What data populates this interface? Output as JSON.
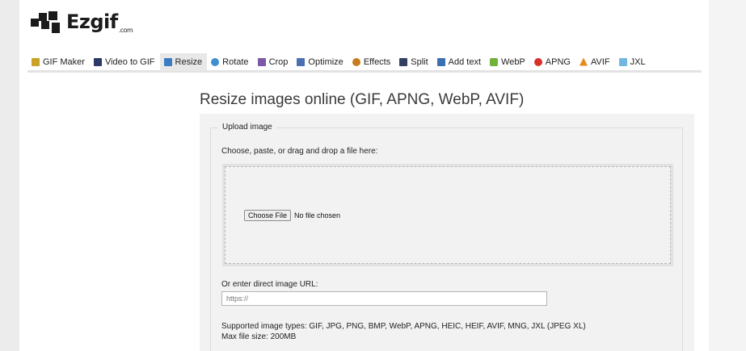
{
  "brand": {
    "name": "Ezgif",
    "suffix": ".com"
  },
  "nav": {
    "items": [
      {
        "label": "GIF Maker",
        "icon": "gif-maker-icon",
        "color": "#c9a227"
      },
      {
        "label": "Video to GIF",
        "icon": "film-icon",
        "color": "#2b3a67"
      },
      {
        "label": "Resize",
        "icon": "resize-icon",
        "color": "#3c7bc4",
        "active": true
      },
      {
        "label": "Rotate",
        "icon": "rotate-icon",
        "color": "#3c8fd1"
      },
      {
        "label": "Crop",
        "icon": "crop-icon",
        "color": "#7a5aa8"
      },
      {
        "label": "Optimize",
        "icon": "optimize-icon",
        "color": "#4a6fb3"
      },
      {
        "label": "Effects",
        "icon": "effects-icon",
        "color": "#c77a1e"
      },
      {
        "label": "Split",
        "icon": "split-icon",
        "color": "#333f63"
      },
      {
        "label": "Add text",
        "icon": "add-text-icon",
        "color": "#3b6fb0"
      },
      {
        "label": "WebP",
        "icon": "webp-icon",
        "color": "#6fb23a"
      },
      {
        "label": "APNG",
        "icon": "apng-icon",
        "color": "#d9302c"
      },
      {
        "label": "AVIF",
        "icon": "avif-icon",
        "color": "#e8891f"
      },
      {
        "label": "JXL",
        "icon": "jxl-icon",
        "color": "#6fb8e0"
      }
    ]
  },
  "page": {
    "title": "Resize images online (GIF, APNG, WebP, AVIF)"
  },
  "upload": {
    "legend": "Upload image",
    "instructions": "Choose, paste, or drag and drop a file here:",
    "choose_button": "Choose File",
    "no_file_text": "No file chosen",
    "url_label": "Or enter direct image URL:",
    "url_placeholder": "https://",
    "supported_types": "Supported image types: GIF, JPG, PNG, BMP, WebP, APNG, HEIC, HEIF, AVIF, MNG, JXL (JPEG XL)",
    "max_size": "Max file size: 200MB"
  }
}
